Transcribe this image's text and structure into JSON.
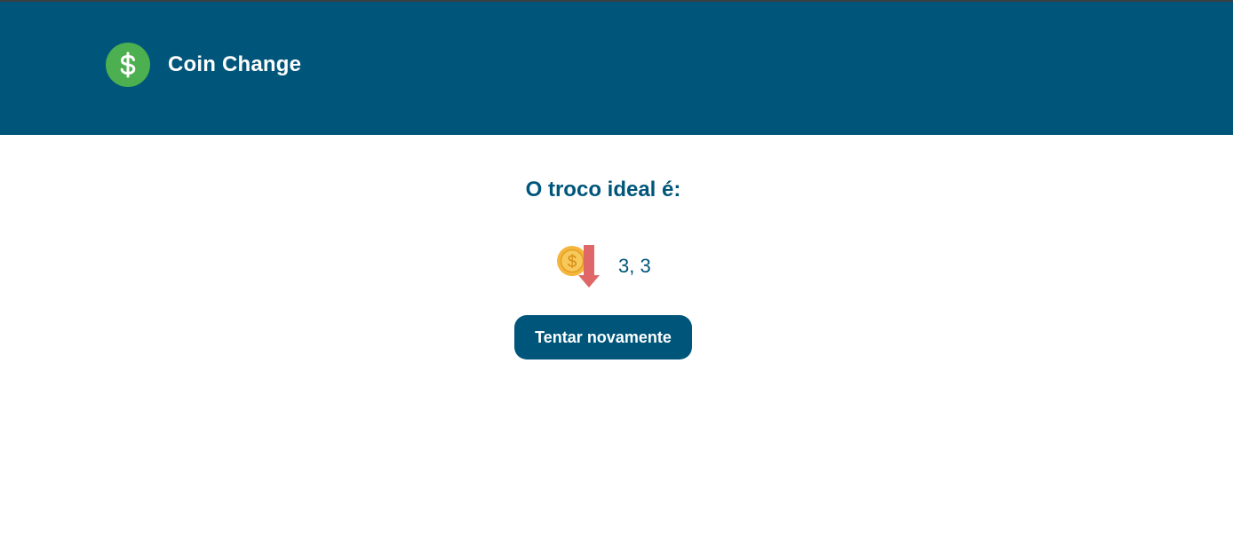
{
  "header": {
    "app_title": "Coin Change",
    "logo_icon": "dollar-circle-icon",
    "background_color": "#00567a",
    "logo_color": "#4caf50"
  },
  "result": {
    "title": "O troco ideal é:",
    "icon": "coin-down-arrow-icon",
    "value": "3, 3"
  },
  "actions": {
    "retry_label": "Tentar novamente"
  }
}
